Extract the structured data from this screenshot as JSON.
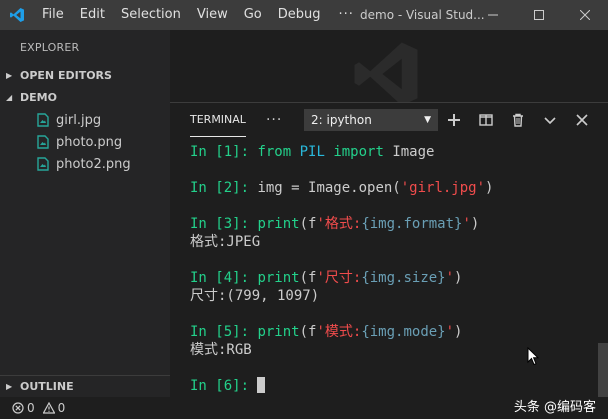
{
  "colors": {
    "titlebar": "#3c3c3c",
    "sidebar": "#252526",
    "editor": "#1e1e1e",
    "accent": "#007acc",
    "prompt_green": "#23d18b",
    "string_red": "#f14c4c"
  },
  "titlebar": {
    "menu": [
      "File",
      "Edit",
      "Selection",
      "View",
      "Go",
      "Debug",
      "···"
    ],
    "window_title": "demo - Visual Stud...",
    "icons": [
      "vscode-logo-icon",
      "minimize-icon",
      "maximize-icon",
      "close-icon"
    ]
  },
  "sidebar": {
    "header": "EXPLORER",
    "open_editors": "OPEN EDITORS",
    "folder": "DEMO",
    "files": [
      "girl.jpg",
      "photo.png",
      "photo2.png"
    ],
    "outline": "OUTLINE"
  },
  "panel": {
    "tab": "TERMINAL",
    "more": "···",
    "terminal_select": "2: ipython",
    "actions": [
      "plus-icon",
      "split-icon",
      "trash-icon",
      "chevron-down-icon",
      "close-icon"
    ]
  },
  "terminal": {
    "l1": {
      "prompt": "In [1]: ",
      "kw1": "from",
      "mod": " PIL ",
      "kw2": "import",
      "rest": " Image"
    },
    "l2": {
      "prompt": "In [2]: ",
      "code": "img = Image.open(",
      "str": "'girl.jpg'",
      "close": ")"
    },
    "l3": {
      "prompt": "In [3]: ",
      "fn": "print",
      "open": "(f",
      "str1": "'格式:",
      "fmt": "{img.format}",
      "str2": "'",
      "close": ")",
      "out": "格式:JPEG"
    },
    "l4": {
      "prompt": "In [4]: ",
      "fn": "print",
      "open": "(f",
      "str1": "'尺寸:",
      "fmt": "{img.size}",
      "str2": "'",
      "close": ")",
      "out": "尺寸:(799, 1097)"
    },
    "l5": {
      "prompt": "In [5]: ",
      "fn": "print",
      "open": "(f",
      "str1": "'模式:",
      "fmt": "{img.mode}",
      "str2": "'",
      "close": ")",
      "out": "模式:RGB"
    },
    "l6": {
      "prompt": "In [6]: "
    }
  },
  "statusbar": {
    "errors": "0",
    "warnings": "0",
    "brand": "头条 @编码客"
  }
}
